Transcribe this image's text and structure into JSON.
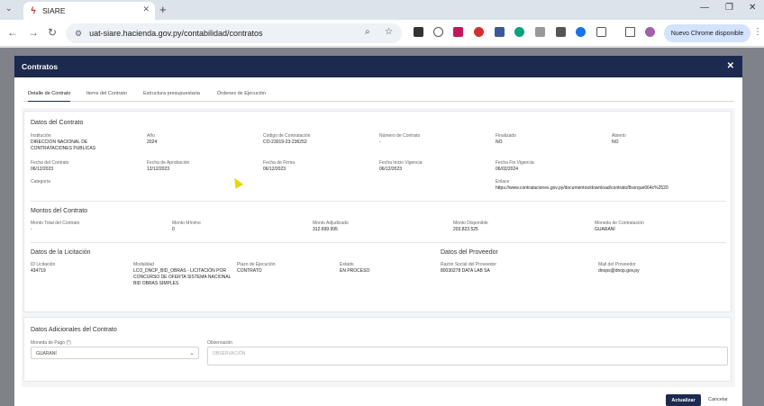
{
  "browser": {
    "tab_title": "SIARE",
    "tab_favicon": "siare-logo-icon",
    "url": "uat-siare.hacienda.gov.py/contabilidad/contratos",
    "update_label": "Nuevo Chrome disponible"
  },
  "modal": {
    "title": "Contratos",
    "tabs": [
      {
        "label": "Detalle de Contrato"
      },
      {
        "label": "Items del Contrato"
      },
      {
        "label": "Estructura presupuestaria"
      },
      {
        "label": "Órdenes de Ejecución"
      }
    ],
    "datos_contrato": {
      "title": "Datos del Contrato",
      "fields": [
        {
          "label": "Institución",
          "value": "DIRECCION NACIONAL DE CONTRATACIONES PUBLICAS"
        },
        {
          "label": "Año",
          "value": "2024"
        },
        {
          "label": "Código de Contratación",
          "value": "CO-23019-23-236252"
        },
        {
          "label": "Número de Contrato",
          "value": "-"
        },
        {
          "label": "Finalizado",
          "value": "NO"
        },
        {
          "label": "Abierto",
          "value": "NO"
        },
        {
          "label": "Fecha del Contrato",
          "value": "06/12/2023"
        },
        {
          "label": "Fecha de Aprobación",
          "value": "12/12/2023"
        },
        {
          "label": "Fecha de Firma",
          "value": "06/12/2023"
        },
        {
          "label": "Fecha Inicio Vigencia",
          "value": "06/12/2023"
        },
        {
          "label": "Fecha Fin Vigencia",
          "value": "06/02/2024"
        }
      ],
      "categoria_label": "Categoría",
      "enlace_label": "Enlace",
      "enlace_value": "https://www.contrataciones.gov.py/documentos/download/contrato/8sxrque664c%2520"
    },
    "montos": {
      "title": "Montos del Contrato",
      "fields": [
        {
          "label": "Monto Total del Contrato",
          "value": "-"
        },
        {
          "label": "Monto Mínimo",
          "value": "0"
        },
        {
          "label": "Monto Adjudicado",
          "value": "312.699.995"
        },
        {
          "label": "Monto Disponible",
          "value": "203.823.525"
        },
        {
          "label": "Moneda de Contratación",
          "value": "GUARANÍ"
        }
      ]
    },
    "licitacion": {
      "title": "Datos de la Licitación",
      "fields": [
        {
          "label": "ID Licitación",
          "value": "434719"
        },
        {
          "label": "Modalidad",
          "value": "LCO_DNCP_BID_OBRAS - LICITACIÓN POR CONCURSO DE OFERTA SISTEMA NACIONAL BID OBRAS SIMPLES"
        },
        {
          "label": "Plazo de Ejecución",
          "value": "CONTRATO"
        },
        {
          "label": "Estado",
          "value": "EN PROCESO"
        }
      ]
    },
    "proveedor": {
      "title": "Datos del Proveedor",
      "fields": [
        {
          "label": "Razón Social del Proveedor",
          "value": "80030278 DATA LAB SA"
        },
        {
          "label": "Mail del Proveedor",
          "value": "dnops@dnop.gov.py"
        }
      ]
    },
    "adicionales": {
      "title": "Datos Adicionales del Contrato",
      "moneda_label": "Moneda de Pago (*)",
      "moneda_value": "GUARANÍ",
      "observacion_label": "Observación",
      "observacion_placeholder": "OBSERVACIÓN"
    },
    "actions": {
      "update_label": "Actualizar",
      "cancel_label": "Cancelar"
    }
  }
}
